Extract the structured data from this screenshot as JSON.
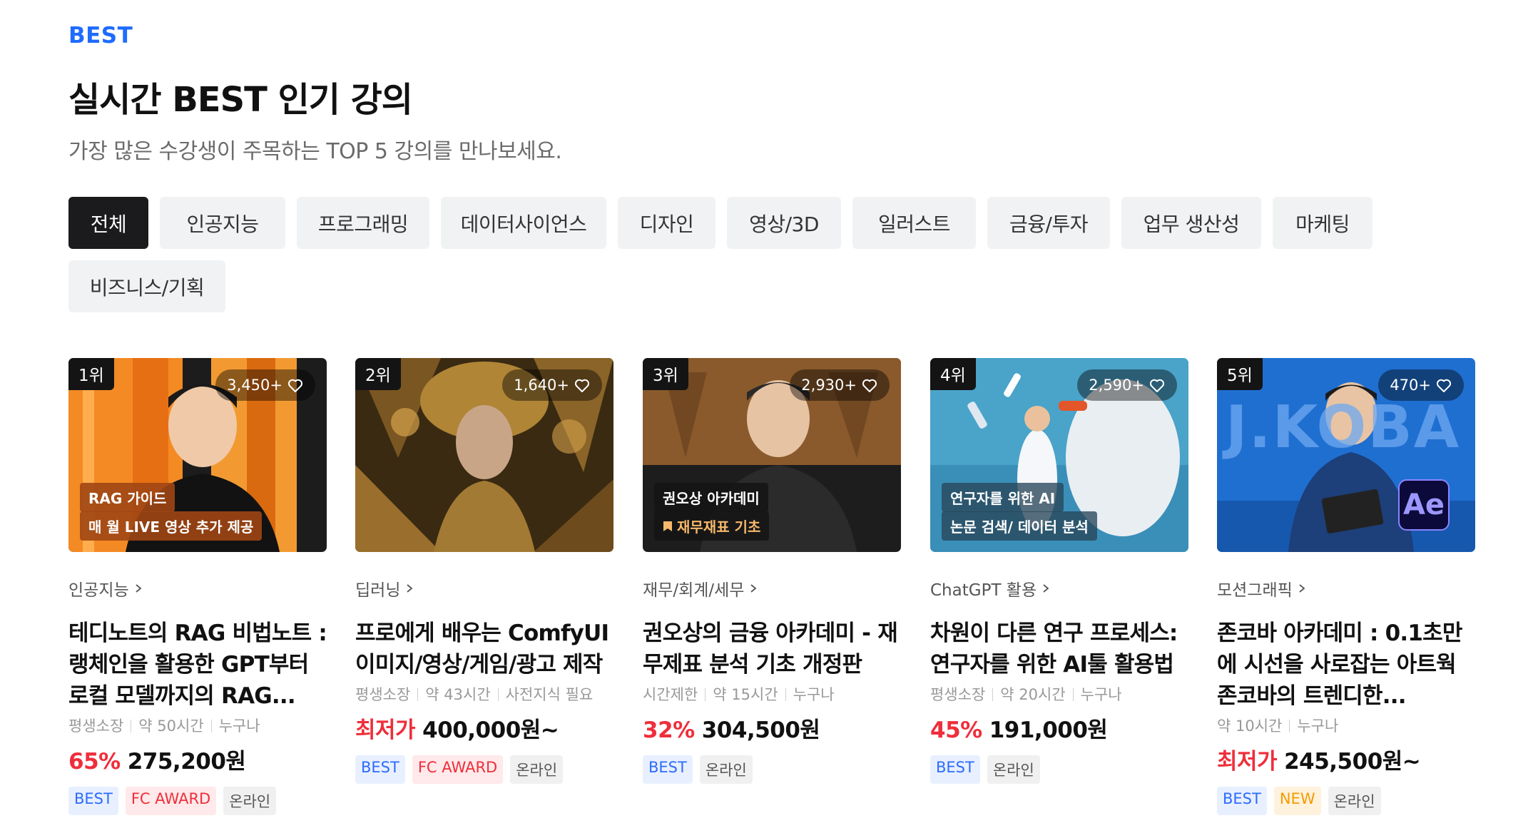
{
  "header": {
    "eyebrow": "BEST",
    "title": "실시간 BEST 인기 강의",
    "subtitle": "가장 많은 수강생이 주목하는 TOP 5 강의를 만나보세요."
  },
  "tabs": [
    "전체",
    "인공지능",
    "프로그래밍",
    "데이터사이언스",
    "디자인",
    "영상/3D",
    "일러스트",
    "금융/투자",
    "업무 생산성",
    "마케팅",
    "비즈니스/기획"
  ],
  "active_tab": "전체",
  "courses": [
    {
      "rank": "1위",
      "likes": "3,450+",
      "overlay": [
        "RAG 가이드",
        "매 월 LIVE 영상 추가 제공"
      ],
      "category": "인공지능",
      "title": "테디노트의 RAG 비법노트 : 랭체인을 활용한 GPT부터 로컬 모델까지의 RAG...",
      "meta": [
        "평생소장",
        "약 50시간",
        "누구나"
      ],
      "discount": "65%",
      "price": "275,200원",
      "tags": [
        "BEST",
        "FC AWARD",
        "온라인"
      ]
    },
    {
      "rank": "2위",
      "likes": "1,640+",
      "overlay": [],
      "category": "딥러닝",
      "title": "프로에게 배우는 ComfyUI 이미지/영상/게임/광고 제작",
      "meta": [
        "평생소장",
        "약 43시간",
        "사전지식 필요"
      ],
      "discount": "최저가",
      "price": "400,000원~",
      "tags": [
        "BEST",
        "FC AWARD",
        "온라인"
      ]
    },
    {
      "rank": "3위",
      "likes": "2,930+",
      "overlay": [
        "권오상 아카데미",
        "재무재표 기초"
      ],
      "category": "재무/회계/세무",
      "title": "권오상의 금융 아카데미 - 재무제표 분석 기초 개정판",
      "meta": [
        "시간제한",
        "약 15시간",
        "누구나"
      ],
      "discount": "32%",
      "price": "304,500원",
      "tags": [
        "BEST",
        "온라인"
      ]
    },
    {
      "rank": "4위",
      "likes": "2,590+",
      "overlay": [
        "연구자를 위한 AI",
        "논문 검색/ 데이터 분석"
      ],
      "category": "ChatGPT 활용",
      "title": "차원이 다른 연구 프로세스: 연구자를 위한 AI툴 활용법",
      "meta": [
        "평생소장",
        "약 20시간",
        "누구나"
      ],
      "discount": "45%",
      "price": "191,000원",
      "tags": [
        "BEST",
        "온라인"
      ]
    },
    {
      "rank": "5위",
      "likes": "470+",
      "overlay": [
        "J.KOBA",
        "Ae"
      ],
      "category": "모션그래픽",
      "title": "존코바 아카데미 : 0.1초만에 시선을 사로잡는 아트웍 존코바의 트렌디한...",
      "meta": [
        "약 10시간",
        "누구나"
      ],
      "discount": "최저가",
      "price": "245,500원~",
      "tags": [
        "BEST",
        "NEW",
        "온라인"
      ]
    }
  ],
  "colors": {
    "accent": "#1f6bff",
    "discount": "#ef2e3b",
    "active_tab": "#1b1b1d"
  },
  "icons": [
    "heart-icon",
    "chevron-right-icon",
    "bookmark-icon"
  ]
}
